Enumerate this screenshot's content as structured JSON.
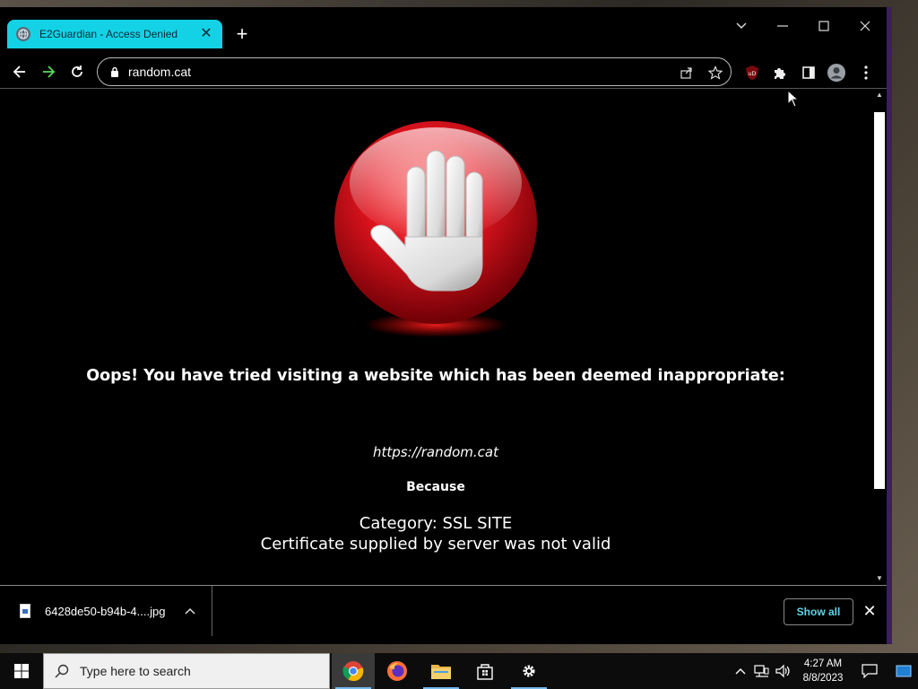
{
  "browser": {
    "tab": {
      "title": "E2Guardian - Access Denied",
      "close": "✕"
    },
    "new_tab": "+",
    "window_controls": {
      "tab_search": "⌄",
      "minimize": "—",
      "maximize": "☐",
      "close": "✕"
    },
    "address": {
      "url": "random.cat"
    }
  },
  "page": {
    "message": "Oops! You have tried visiting a website which has been deemed inappropriate:",
    "blocked_url": "https://random.cat",
    "because": "Because",
    "category": "Category: SSL SITE",
    "reason": "Certificate supplied by server was not valid"
  },
  "downloads": {
    "file_name": "6428de50-b94b-4....jpg",
    "show_all": "Show all",
    "close": "✕"
  },
  "taskbar": {
    "search_placeholder": "Type here to search",
    "time": "4:27 AM",
    "date": "8/8/2023"
  },
  "colors": {
    "tab_active": "#14d2e6",
    "show_all_text": "#5fd3e8",
    "ublock_red": "#c4161c",
    "stop_red": "#e0141e"
  }
}
